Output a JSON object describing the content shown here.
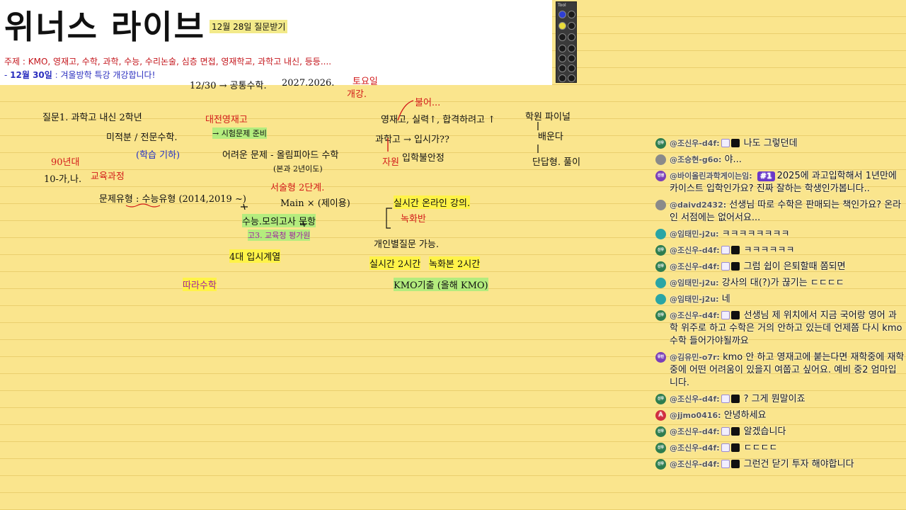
{
  "header": {
    "title": "위너스 라이브",
    "subtitle": "12월 28일 질문받기",
    "topic": "주제 : KMO, 영재고, 수학, 과학, 수능, 수리논술, 심층 면접, 영재학교, 과학고 내신, 등등....",
    "notice_prefix": "- ",
    "notice_date": "12월 30일",
    "notice_sep": " : ",
    "notice_text": "겨울방학 특강 개강합니다!"
  },
  "toolbox": {
    "title": "Tool"
  },
  "notes": {
    "n1": "12/30 → 공통수학.",
    "n2": "2027.2026.",
    "n3": "토요일",
    "n4": "개강.",
    "q1": "질문1. 과학고 내신 2학년",
    "q1b": "미적분 / 전문수학.",
    "q1c": "(학습 기하)",
    "q1d": "90년대",
    "q1e": "10-가,나.",
    "q1f": "교육과정",
    "q1g": "문제유형 : 수능유형 (2014,2019 ~)",
    "d1": "대전영재고",
    "d2": "→ 시험문제 준비",
    "d3": "어려운 문제 - 올림피아드 수학",
    "d4": "(본과 2년이도)",
    "d5": "서술형 2단계.",
    "d6": "Main × (제이용)",
    "d7": "수능.모의고사 문항",
    "d8": "고3. 교육청 평가원",
    "d9": "4대 입시계열",
    "d10": "따라수학",
    "m1": "불어...",
    "m2": "영재고, 실력↑, 합격하려고 ↑",
    "m3": "과학고 → 입시가??",
    "m4": "자원",
    "m5": "입학불안정",
    "m6": "실시간 온라인 강의.",
    "m7": "녹화반",
    "m8": "개인별질문 가능.",
    "m9": "실시간 2시간",
    "m10": "녹화본 2시간",
    "m11": "KMO기출 (올해 KMO)",
    "r1": "학원 파이널",
    "r2": "배운다",
    "r3": "단답형. 풀이"
  },
  "chat": [
    {
      "avatar": "신우",
      "avatar_style": "green",
      "user": "@조신우-d4f:",
      "badges": true,
      "rank": "",
      "text": "나도 그렇던데"
    },
    {
      "avatar": "",
      "avatar_style": "gray",
      "user": "@조승현-g6o:",
      "badges": false,
      "rank": "",
      "text": "야..."
    },
    {
      "avatar": "선생",
      "avatar_style": "purple",
      "user": "@바이올린과학게이는임:",
      "badges": false,
      "rank": "#1",
      "text": "2025에 과고입학해서 1년만에 카이스트 입학인가요? 진짜 잘하는 학생인가봅니다.."
    },
    {
      "avatar": "",
      "avatar_style": "gray",
      "user": "@daivd2432:",
      "badges": false,
      "rank": "",
      "text": "선생님 따로 수학은 판매되는 책인가요? 온라인 서점에는 없어서요..."
    },
    {
      "avatar": "",
      "avatar_style": "teal",
      "user": "@임태민-j2u:",
      "badges": false,
      "rank": "",
      "text": "ㅋㅋㅋㅋㅋㅋㅋㅋ"
    },
    {
      "avatar": "신우",
      "avatar_style": "green",
      "user": "@조신우-d4f:",
      "badges": true,
      "rank": "",
      "text": "ㅋㅋㅋㅋㅋㅋ"
    },
    {
      "avatar": "신우",
      "avatar_style": "green",
      "user": "@조신우-d4f:",
      "badges": true,
      "rank": "",
      "text": "그럼 쉽이 은퇴할때 쫌되면"
    },
    {
      "avatar": "",
      "avatar_style": "teal",
      "user": "@임태민-j2u:",
      "badges": false,
      "rank": "",
      "text": "강사의 대(?)가 끊기는 ㄷㄷㄷㄷ"
    },
    {
      "avatar": "",
      "avatar_style": "teal",
      "user": "@임태민-j2u:",
      "badges": false,
      "rank": "",
      "text": "네"
    },
    {
      "avatar": "신우",
      "avatar_style": "green",
      "user": "@조신우-d4f:",
      "badges": true,
      "rank": "",
      "text": "선생님 제 위치에서 지금 국어랑 영어 과학 위주로 하고 수학은 거의 안하고 있는데 언제쯤 다시 kmo 수학 들어가야될까요"
    },
    {
      "avatar": "유민",
      "avatar_style": "purple",
      "user": "@김유민-o7r:",
      "badges": false,
      "rank": "",
      "text": "kmo 안 하고 영재고에 붙는다면 재학중에 재학중에 어떤 어려움이 있을지 여쭙고 싶어요. 예비 중2 엄마입니다."
    },
    {
      "avatar": "신우",
      "avatar_style": "green",
      "user": "@조신우-d4f:",
      "badges": true,
      "rank": "",
      "text": "? 그게 뭔말이죠"
    },
    {
      "avatar": "A",
      "avatar_style": "red",
      "user": "@jjmo0416:",
      "badges": false,
      "rank": "",
      "text": "안녕하세요"
    },
    {
      "avatar": "신우",
      "avatar_style": "green",
      "user": "@조신우-d4f:",
      "badges": true,
      "rank": "",
      "text": "알겠습니다"
    },
    {
      "avatar": "신우",
      "avatar_style": "green",
      "user": "@조신우-d4f:",
      "badges": true,
      "rank": "",
      "text": "ㄷㄷㄷㄷ"
    },
    {
      "avatar": "신우",
      "avatar_style": "green",
      "user": "@조신우-d4f:",
      "badges": true,
      "rank": "",
      "text": "그런건 닫기 투자 해야합니다"
    }
  ]
}
